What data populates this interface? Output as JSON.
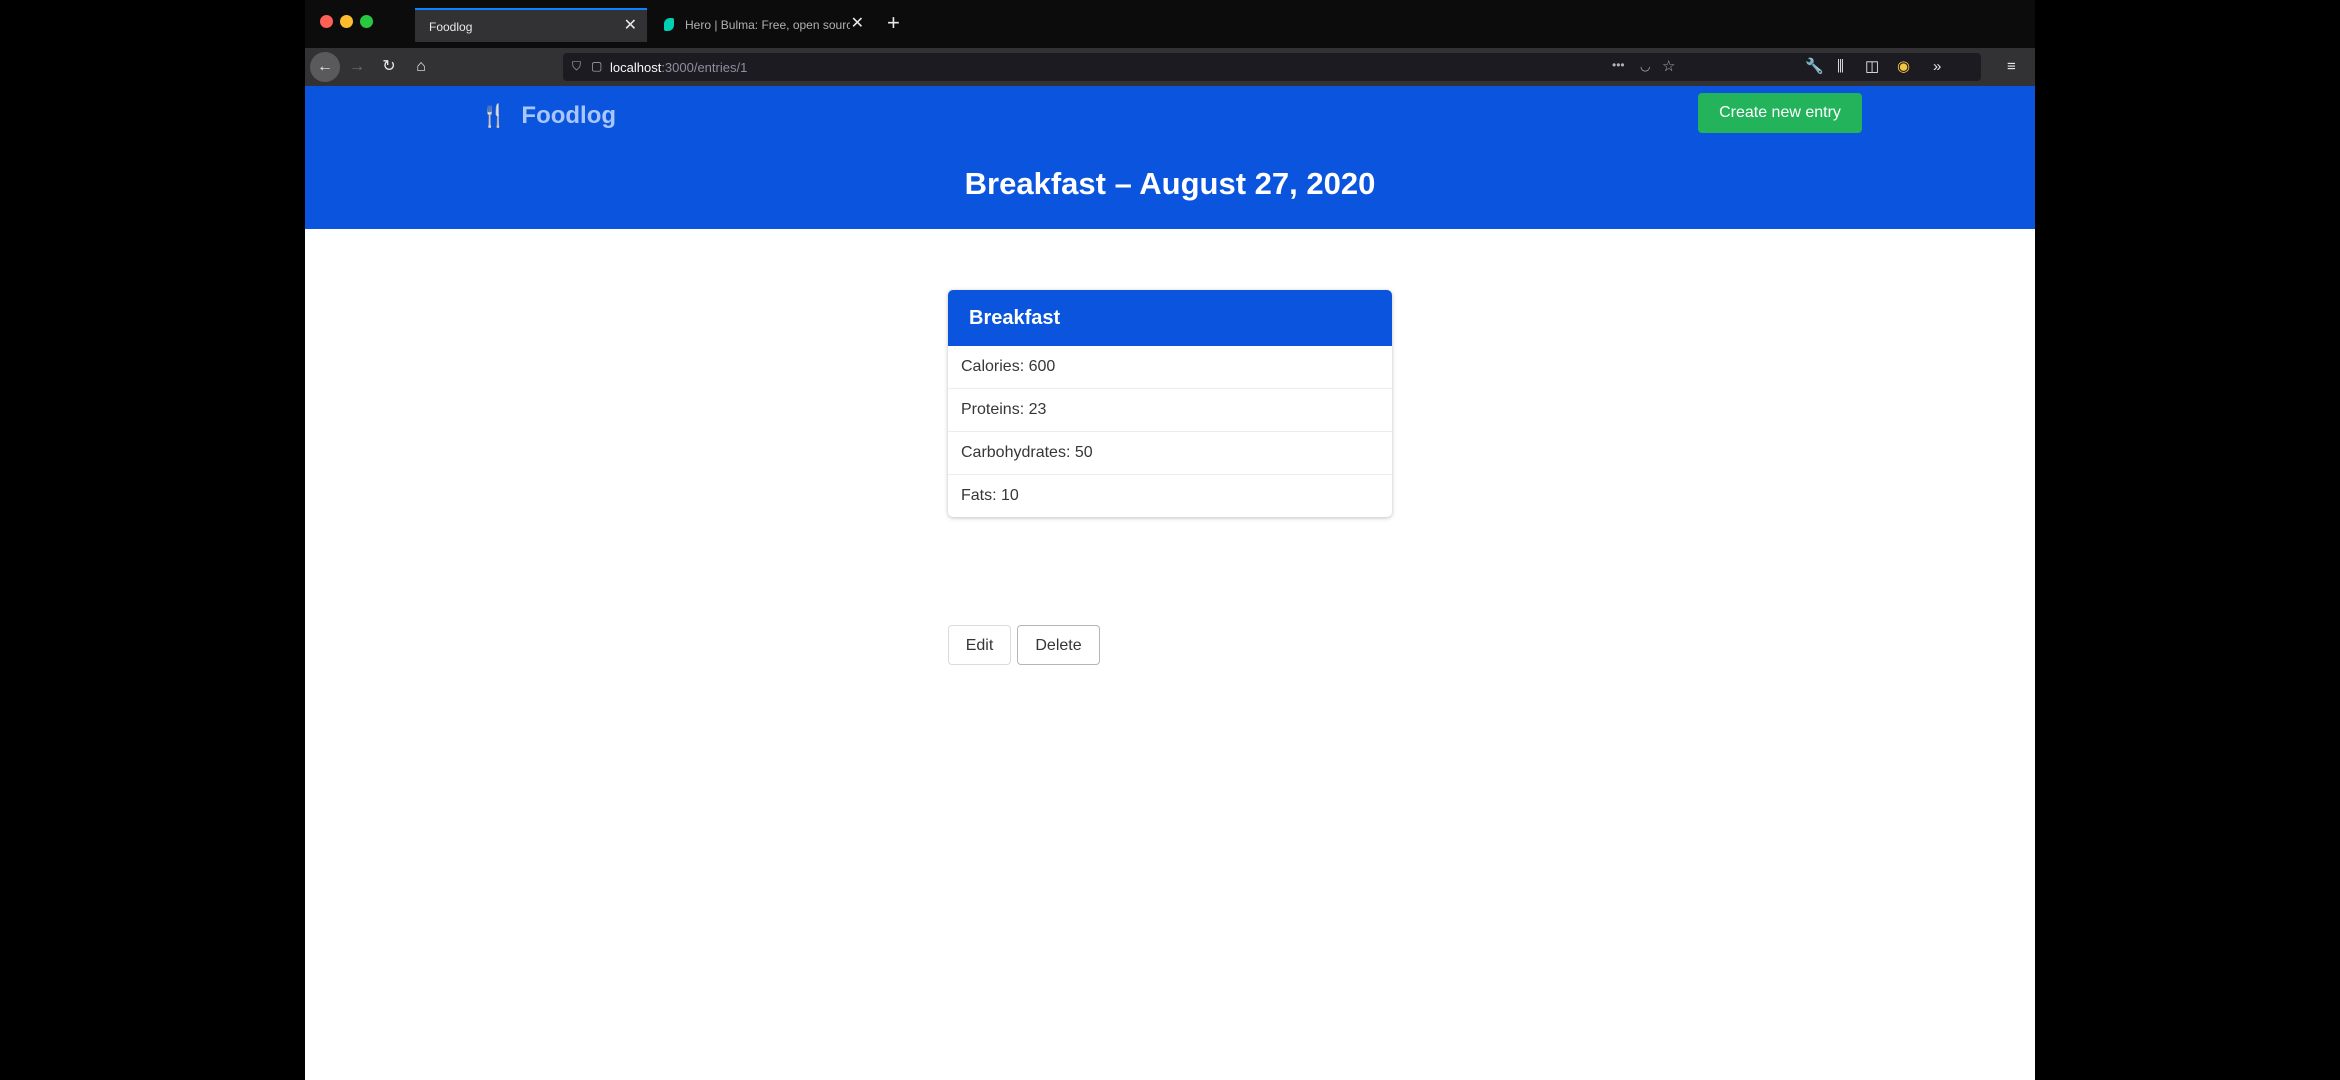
{
  "browser": {
    "tabs": [
      {
        "title": "Foodlog",
        "close": "✕"
      },
      {
        "title": "Hero | Bulma: Free, open source",
        "close": "✕"
      }
    ],
    "new_tab": "+",
    "url_host": "localhost",
    "url_path": ":3000/entries/1",
    "icons": {
      "back": "←",
      "forward": "→",
      "reload": "↻",
      "home": "⌂",
      "shield": "⛉",
      "page": "▢",
      "more": "•••",
      "pocket": "◡",
      "star": "☆",
      "wrench": "🔧",
      "library": "⫼",
      "sidebar": "◫",
      "extension": "◉",
      "overflow": "»",
      "menu": "≡"
    }
  },
  "app": {
    "brand_icon": "🍴",
    "brand": "Foodlog",
    "create_button": "Create new entry",
    "hero_title": "Breakfast – August 27, 2020",
    "card": {
      "header": "Breakfast",
      "items": [
        "Calories: 600",
        "Proteins: 23",
        "Carbohydrates: 50",
        "Fats: 10"
      ]
    },
    "actions": {
      "edit": "Edit",
      "delete": "Delete"
    },
    "colors": {
      "primary": "#0b55de",
      "success": "#23b35b"
    }
  }
}
